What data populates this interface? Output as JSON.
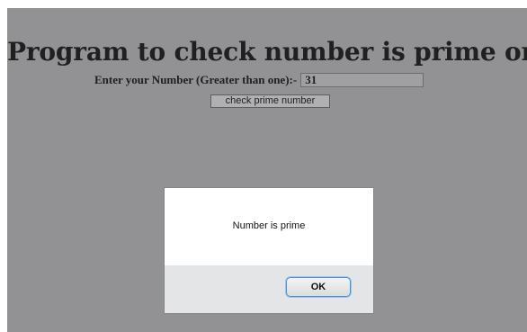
{
  "page": {
    "title": "Program to check number is prime or not"
  },
  "form": {
    "label": "Enter your Number (Greater than one):-",
    "input_value": "31",
    "check_button_label": "check prime number"
  },
  "dialog": {
    "message": "Number is prime",
    "ok_label": "OK"
  },
  "colors": {
    "page_background": "#929295",
    "dialog_background": "#ffffff",
    "dialog_footer": "#e4e5e7",
    "ok_focus_ring": "#4a90d9"
  }
}
